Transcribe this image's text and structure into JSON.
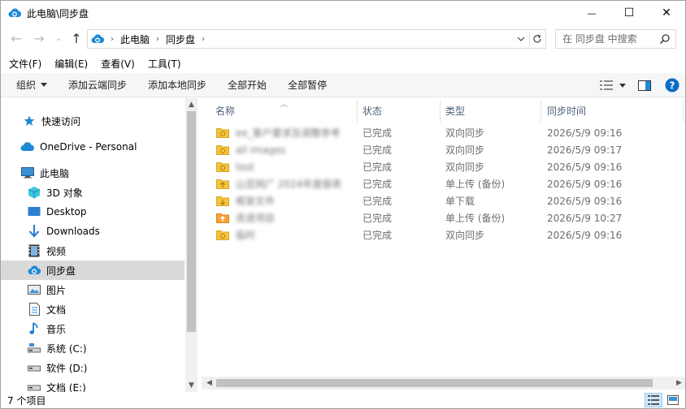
{
  "window": {
    "title": "此电脑\\同步盘",
    "minimize_glyph": "—",
    "maximize_glyph": "☐",
    "close_glyph": "✕"
  },
  "address": {
    "crumbs": [
      "此电脑",
      "同步盘"
    ],
    "search_placeholder": "在 同步盘 中搜索"
  },
  "menu": [
    "文件(F)",
    "编辑(E)",
    "查看(V)",
    "工具(T)"
  ],
  "toolbar": {
    "organize": "组织",
    "add_cloud_sync": "添加云端同步",
    "add_local_sync": "添加本地同步",
    "start_all": "全部开始",
    "pause_all": "全部暂停"
  },
  "nav": {
    "quick_access": "快速访问",
    "onedrive": "OneDrive - Personal",
    "this_pc": "此电脑",
    "objects3d": "3D 对象",
    "desktop": "Desktop",
    "downloads": "Downloads",
    "videos": "视频",
    "sync_disk": "同步盘",
    "pictures": "图片",
    "documents": "文档",
    "music": "音乐",
    "drive_c": "系统 (C:)",
    "drive_d": "软件 (D:)",
    "drive_e": "文档 (E:)"
  },
  "columns": {
    "name": "名称",
    "status": "状态",
    "type": "类型",
    "sync_time": "同步时间"
  },
  "files": [
    {
      "name": "ee_客户要求及调整参考",
      "status": "已完成",
      "type": "双向同步",
      "time": "2026/5/9 09:16",
      "icon": "folder-sync-icon"
    },
    {
      "name": "all images",
      "status": "已完成",
      "type": "双向同步",
      "time": "2026/5/9 09:17",
      "icon": "folder-sync-icon"
    },
    {
      "name": "test",
      "status": "已完成",
      "type": "双向同步",
      "time": "2026/5/9 09:16",
      "icon": "folder-sync-icon"
    },
    {
      "name": "山豆网广 2024年度报表",
      "status": "已完成",
      "type": "单上传 (备份)",
      "time": "2026/5/9 09:16",
      "icon": "folder-upload-icon"
    },
    {
      "name": "框架文件",
      "status": "已完成",
      "type": "单下载",
      "time": "2026/5/9 09:16",
      "icon": "folder-download-icon"
    },
    {
      "name": "迭退项目",
      "status": "已完成",
      "type": "单上传 (备份)",
      "time": "2026/5/9 10:27",
      "icon": "folder-upload-orange-icon"
    },
    {
      "name": "临时",
      "status": "已完成",
      "type": "双向同步",
      "time": "2026/5/9 09:16",
      "icon": "folder-sync-icon"
    }
  ],
  "statusbar": {
    "item_count": "7 个项目"
  },
  "colors": {
    "folder": "#f3c53f",
    "sync_blue": "#1f8ad6",
    "selected_nav": "#d9d9d9"
  }
}
